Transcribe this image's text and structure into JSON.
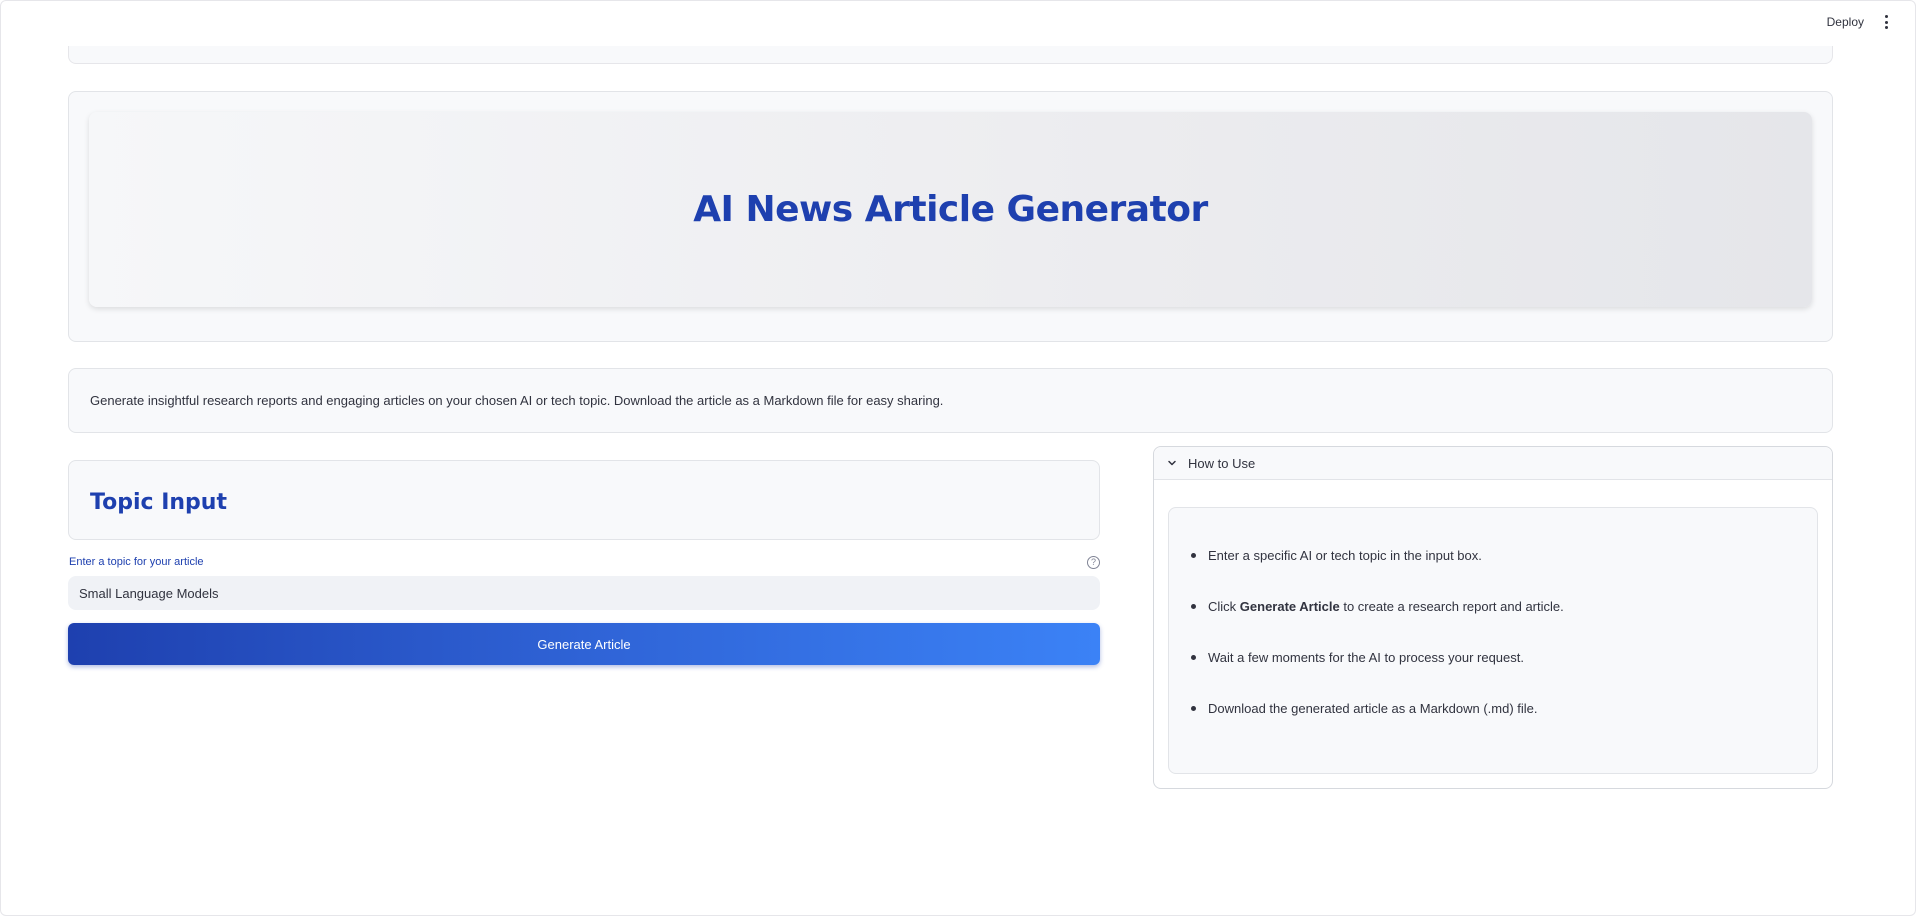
{
  "header": {
    "deploy_label": "Deploy"
  },
  "hero": {
    "title": "AI News Article Generator"
  },
  "description": "Generate insightful research reports and engaging articles on your chosen AI or tech topic. Download the article as a Markdown file for easy sharing.",
  "topic_section": {
    "heading": "Topic Input",
    "field_label": "Enter a topic for your article",
    "help_icon": "?",
    "input_value": "Small Language Models",
    "button_label": "Generate Article"
  },
  "how_to_use": {
    "title": "How to Use",
    "items": [
      {
        "text": "Enter a specific AI or tech topic in the input box."
      },
      {
        "prefix": "Click ",
        "bold": "Generate Article",
        "suffix": " to create a research report and article."
      },
      {
        "text": "Wait a few moments for the AI to process your request."
      },
      {
        "text": "Download the generated article as a Markdown (.md) file."
      }
    ]
  },
  "colors": {
    "accent": "#1e40af",
    "button_gradient_end": "#3b82f6"
  }
}
